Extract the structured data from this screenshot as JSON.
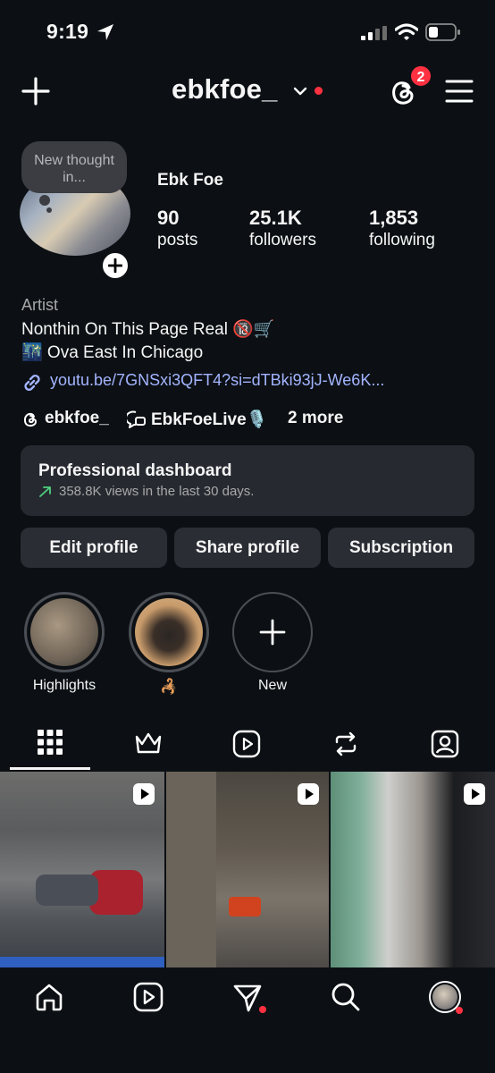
{
  "status": {
    "time": "9:19"
  },
  "header": {
    "username": "ebkfoe_",
    "threads_badge": "2"
  },
  "profile": {
    "bubble": "New thought in...",
    "name": "Ebk Foe",
    "stats": [
      {
        "value": "90",
        "label": "posts"
      },
      {
        "value": "25.1K",
        "label": "followers"
      },
      {
        "value": "1,853",
        "label": "following"
      }
    ],
    "category": "Artist",
    "bio_line1": "Nonthin On This Page Real 🔞🛒",
    "bio_line2": "🌃 Ova East In Chicago",
    "link": "youtu.be/7GNSxi3QFT4?si=dTBki93jJ-We6K...",
    "threads_handle": "ebkfoe_",
    "chat_handle": "EbkFoeLive🎙️",
    "more": "2 more"
  },
  "dashboard": {
    "title": "Professional dashboard",
    "subtitle": "358.8K views in the last 30 days."
  },
  "buttons": {
    "edit": "Edit profile",
    "share": "Share profile",
    "subscription": "Subscription"
  },
  "highlights": [
    {
      "label": "Highlights"
    },
    {
      "label": "🦂"
    },
    {
      "label": "New"
    }
  ],
  "tabs": [
    "grid-icon",
    "crown-icon",
    "reels-icon",
    "repost-icon",
    "tagged-icon"
  ],
  "colors": {
    "background": "#0c1014",
    "accent": "#ff3040",
    "link": "#a3b4ff",
    "button": "#2a2d33"
  }
}
